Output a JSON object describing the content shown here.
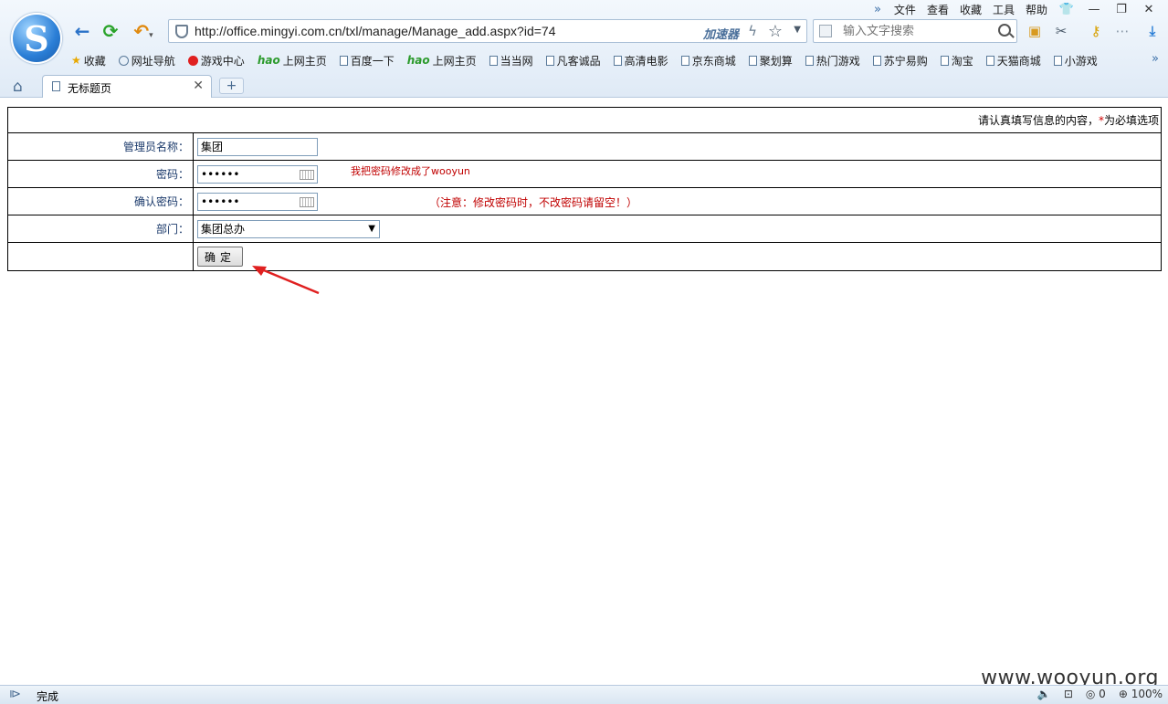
{
  "browser": {
    "menu": [
      "文件",
      "查看",
      "收藏",
      "工具",
      "帮助"
    ],
    "url": "http://office.mingyi.com.cn/txl/manage/Manage_add.aspx?id=74",
    "accelerator_label": "加速器",
    "search_placeholder": "输入文字搜索",
    "favorites": [
      {
        "label": "收藏",
        "icon": "star-icon"
      },
      {
        "label": "网址导航",
        "icon": "globe-icon"
      },
      {
        "label": "游戏中心",
        "icon": "game-icon"
      },
      {
        "label": "上网主页",
        "icon": "hao-icon"
      },
      {
        "label": "百度一下",
        "icon": "page-icon"
      },
      {
        "label": "上网主页",
        "icon": "hao-icon"
      },
      {
        "label": "当当网",
        "icon": "page-icon"
      },
      {
        "label": "凡客诚品",
        "icon": "page-icon"
      },
      {
        "label": "高清电影",
        "icon": "page-icon"
      },
      {
        "label": "京东商城",
        "icon": "page-icon"
      },
      {
        "label": "聚划算",
        "icon": "page-icon"
      },
      {
        "label": "热门游戏",
        "icon": "page-icon"
      },
      {
        "label": "苏宁易购",
        "icon": "page-icon"
      },
      {
        "label": "淘宝",
        "icon": "page-icon"
      },
      {
        "label": "天猫商城",
        "icon": "page-icon"
      },
      {
        "label": "小游戏",
        "icon": "page-icon"
      }
    ],
    "tab_title": "无标题页"
  },
  "form": {
    "header_text": "请认真填写信息的内容，",
    "required_mark": "*",
    "header_suffix": "为必填选项",
    "admin_name_label": "管理员名称：",
    "admin_name_value": "集团",
    "password_label": "密码：",
    "password_value": "••••••",
    "password_note": "我把密码修改成了wooyun",
    "confirm_label": "确认密码：",
    "confirm_value": "••••••",
    "confirm_note": "（注意：修改密码时，不改密码请留空！）",
    "dept_label": "部门：",
    "dept_value": "集团总办",
    "submit_label": "确定"
  },
  "watermark": "www.wooyun.org",
  "status": {
    "text": "完成",
    "count": "0",
    "zoom": "100%"
  },
  "colors": {
    "label_text": "#1b3a6b",
    "note_red": "#c00000",
    "arrow_red": "#e02020"
  }
}
